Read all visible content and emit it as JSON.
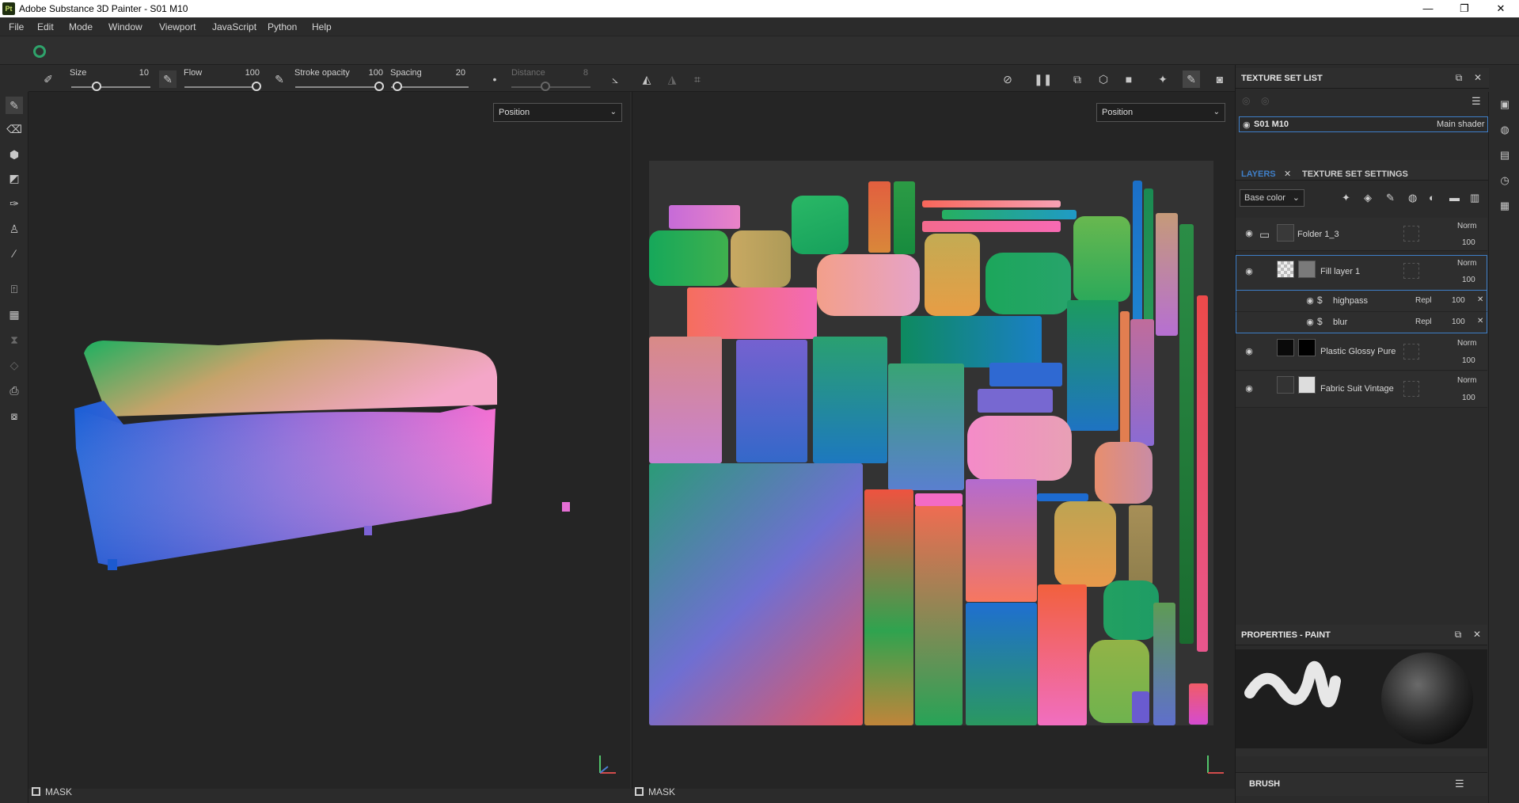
{
  "window": {
    "title": "Adobe Substance 3D Painter - S01 M10",
    "app_icon": "Pt",
    "minimize": "—",
    "maximize": "❐",
    "close": "✕"
  },
  "menu": [
    "File",
    "Edit",
    "Mode",
    "Window",
    "Viewport",
    "JavaScript",
    "Python",
    "Help"
  ],
  "toolbar": {
    "size": {
      "label": "Size",
      "value": "10"
    },
    "flow": {
      "label": "Flow",
      "value": "100"
    },
    "stroke_opacity": {
      "label": "Stroke opacity",
      "value": "100"
    },
    "spacing": {
      "label": "Spacing",
      "value": "20"
    },
    "distance": {
      "label": "Distance",
      "value": "8"
    }
  },
  "viewport3d": {
    "channel": "Position",
    "mask_label": "MASK"
  },
  "viewport2d": {
    "channel": "Position",
    "mask_label": "MASK"
  },
  "texture_set_list": {
    "title": "TEXTURE SET LIST",
    "set_name": "S01 M10",
    "shader": "Main shader"
  },
  "tabs": {
    "layers": "LAYERS",
    "texture_set_settings": "TEXTURE SET SETTINGS"
  },
  "channel_select": "Base color",
  "layers": [
    {
      "name": "Folder 1_3",
      "blend": "Norm",
      "opacity": "100"
    },
    {
      "name": "Fill layer 1",
      "blend": "Norm",
      "opacity": "100"
    },
    {
      "name": "Plastic Glossy Pure",
      "blend": "Norm",
      "opacity": "100"
    },
    {
      "name": "Fabric Suit Vintage",
      "blend": "Norm",
      "opacity": "100"
    }
  ],
  "effects": [
    {
      "name": "highpass",
      "blend": "Repl",
      "opacity": "100"
    },
    {
      "name": "blur",
      "blend": "Repl",
      "opacity": "100"
    }
  ],
  "properties": {
    "title": "PROPERTIES - PAINT",
    "brush_label": "BRUSH"
  },
  "colors": {
    "accent": "#3f7fc8",
    "panel": "#2b2b2b",
    "viewport": "#252525"
  }
}
